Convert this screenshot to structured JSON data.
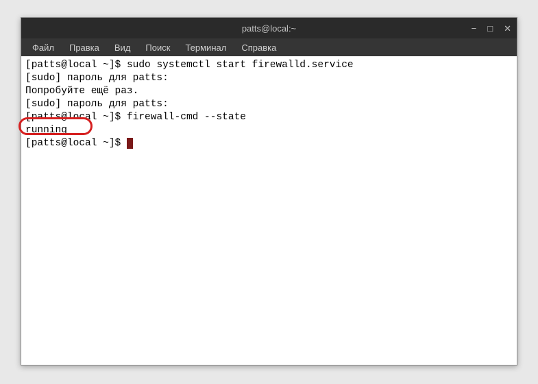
{
  "window": {
    "title": "patts@local:~"
  },
  "controls": {
    "minimize": "−",
    "maximize": "□",
    "close": "✕"
  },
  "menu": {
    "file": "Файл",
    "edit": "Правка",
    "view": "Вид",
    "search": "Поиск",
    "terminal": "Терминал",
    "help": "Справка"
  },
  "terminal": {
    "line1_prompt": "[patts@local ~]$ ",
    "line1_cmd": "sudo systemctl start firewalld.service",
    "line2": "[sudo] пароль для patts: ",
    "line3": "Попробуйте ещё раз.",
    "line4": "[sudo] пароль для patts: ",
    "line5_prompt": "[patts@local ~]$ ",
    "line5_cmd": "firewall-cmd --state",
    "line6": "running",
    "line7_prompt": "[patts@local ~]$ "
  }
}
